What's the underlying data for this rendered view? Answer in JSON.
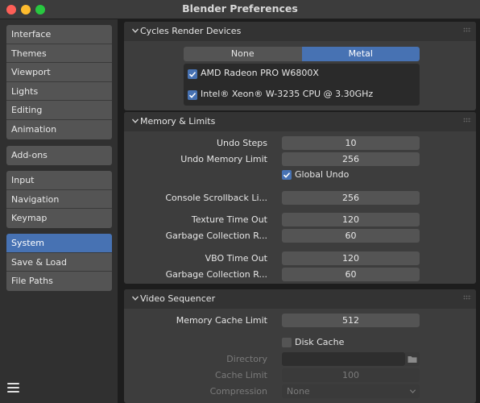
{
  "window": {
    "title": "Blender Preferences"
  },
  "sidebar": {
    "group1": [
      "Interface",
      "Themes",
      "Viewport",
      "Lights",
      "Editing",
      "Animation"
    ],
    "group2": [
      "Add-ons"
    ],
    "group3": [
      "Input",
      "Navigation",
      "Keymap"
    ],
    "group4": [
      "System",
      "Save & Load",
      "File Paths"
    ],
    "active": "System"
  },
  "cycles": {
    "title": "Cycles Render Devices",
    "options": [
      "None",
      "Metal"
    ],
    "selected": "Metal",
    "devices": [
      {
        "name": "AMD Radeon PRO W6800X",
        "checked": true
      },
      {
        "name": "Intel® Xeon® W-3235 CPU @ 3.30GHz",
        "checked": true
      }
    ]
  },
  "memory": {
    "title": "Memory & Limits",
    "undo_steps_label": "Undo Steps",
    "undo_steps": "10",
    "undo_memory_label": "Undo Memory Limit",
    "undo_memory": "256",
    "global_undo_label": "Global Undo",
    "global_undo": true,
    "console_label": "Console Scrollback Li...",
    "console": "256",
    "texture_timeout_label": "Texture Time Out",
    "texture_timeout": "120",
    "gc1_label": "Garbage Collection R...",
    "gc1": "60",
    "vbo_timeout_label": "VBO Time Out",
    "vbo_timeout": "120",
    "gc2_label": "Garbage Collection R...",
    "gc2": "60"
  },
  "video": {
    "title": "Video Sequencer",
    "cache_limit_label": "Memory Cache Limit",
    "cache_limit": "512",
    "disk_cache_label": "Disk Cache",
    "disk_cache": false,
    "directory_label": "Directory",
    "directory": "",
    "disk_cache_limit_label": "Cache Limit",
    "disk_cache_limit": "100",
    "compression_label": "Compression",
    "compression": "None"
  },
  "colors": {
    "accent": "#4772b3",
    "button": "#545454",
    "panel": "#3d3d3d"
  }
}
